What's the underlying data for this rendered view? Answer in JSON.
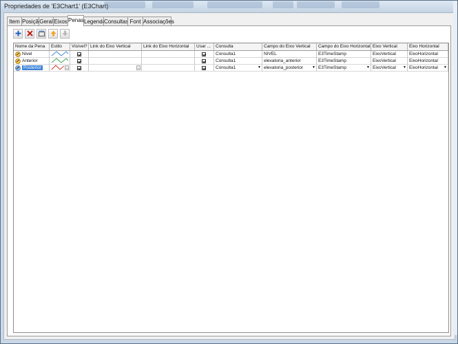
{
  "window": {
    "title": "Propriedades de 'E3Chart1' (E3Chart)"
  },
  "tabs": [
    "Item",
    "Posição",
    "Geral",
    "Eixos",
    "Penas",
    "Legenda",
    "Consultas",
    "Font",
    "Associações"
  ],
  "active_tab": "Penas",
  "toolbar": [
    "add-icon",
    "delete-icon",
    "properties-icon",
    "move-up-icon",
    "move-down-icon"
  ],
  "grid": {
    "columns": [
      "Nome da Pena",
      "Estilo",
      "Visível?",
      "Link do Eixo Vertical",
      "Link do Eixo Horizontal",
      "Usar ...",
      "Consulta",
      "Campo do Eixo Vertical",
      "Campo do Eixo Horizontal",
      "Eixo Vertical",
      "Eixo Horizontal"
    ],
    "rows": [
      {
        "name": "Nivel",
        "style_color": "#3a8ad6",
        "visible": true,
        "link_v": "",
        "link_h": "",
        "usar": true,
        "consulta": "Consulta1",
        "campo_v": "NIVEL",
        "campo_h": "E3TimeStamp",
        "eixo_v": "EixoVertical",
        "eixo_h": "EixoHorizontal"
      },
      {
        "name": "Anterior",
        "style_color": "#3aa64a",
        "visible": true,
        "link_v": "",
        "link_h": "",
        "usar": true,
        "consulta": "Consulta1",
        "campo_v": "elevatoria_anterior",
        "campo_h": "E3TimeStamp",
        "eixo_v": "EixoVertical",
        "eixo_h": "EixoHorizontal"
      },
      {
        "name": "Posterior",
        "style_color": "#d23a2a",
        "visible": true,
        "link_v": "",
        "link_h": "",
        "usar": true,
        "consulta": "Consulta1",
        "campo_v": "elevatoria_posterior",
        "campo_h": "E3TimeStamp",
        "eixo_v": "EixoVertical",
        "eixo_h": "EixoHorizontal",
        "selected": true
      }
    ]
  }
}
